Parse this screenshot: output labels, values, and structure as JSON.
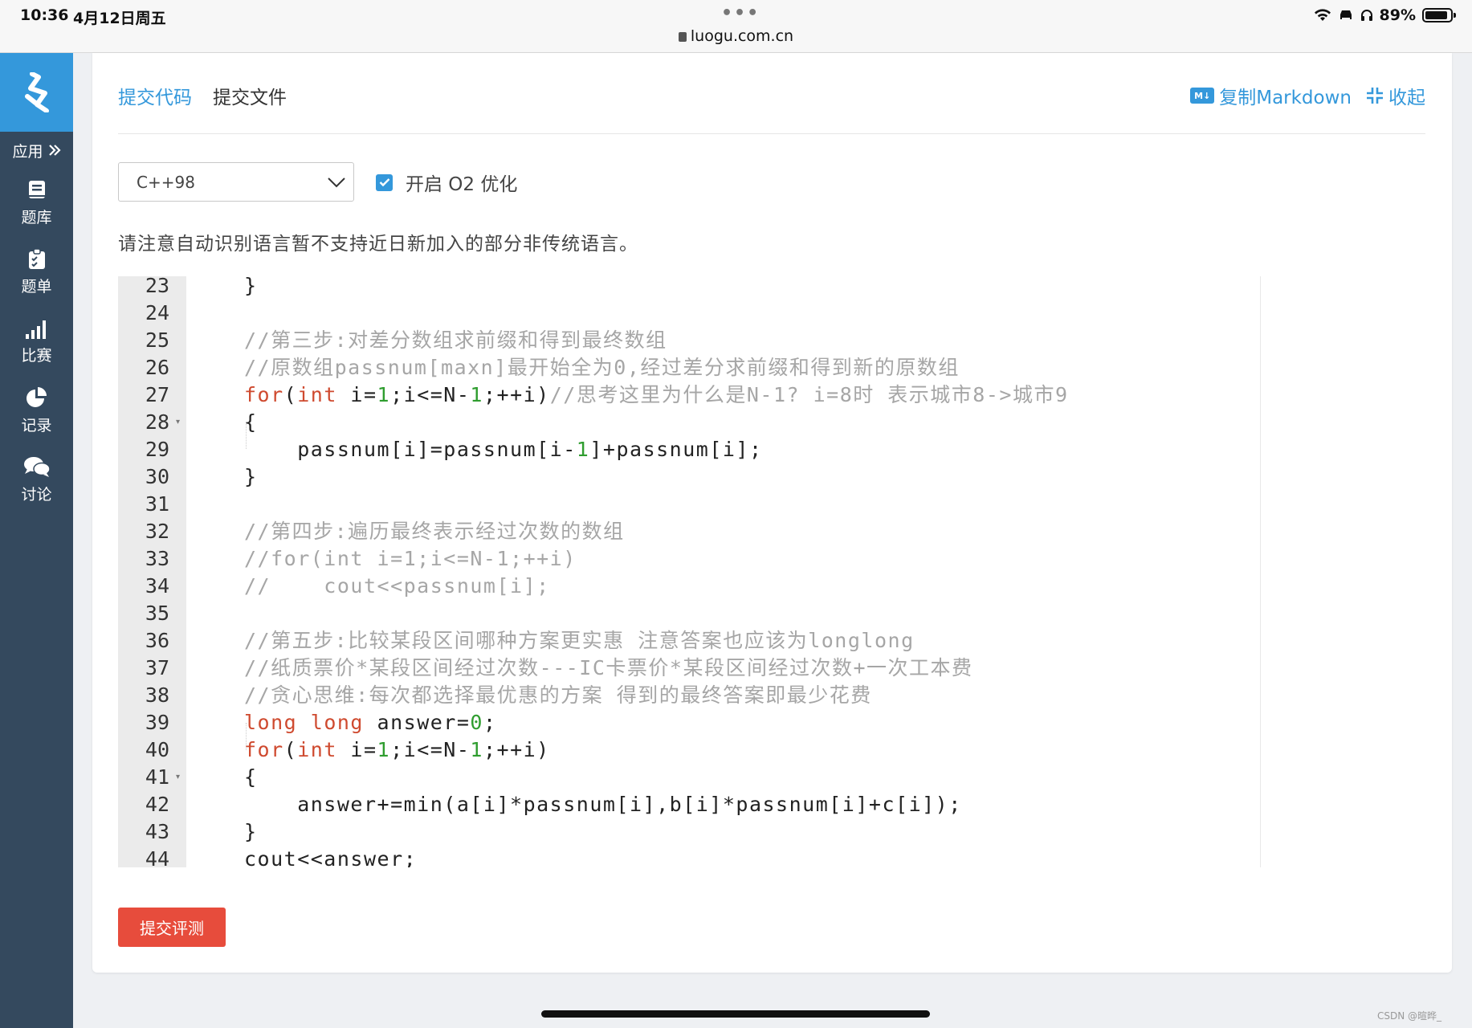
{
  "status": {
    "time": "10:36",
    "date": "4月12日周五",
    "url": "luogu.com.cn",
    "battery": "89%",
    "battery_level": 0.89
  },
  "sidebar": {
    "apps_label": "应用",
    "items": [
      {
        "label": "题库",
        "icon": "book-icon"
      },
      {
        "label": "题单",
        "icon": "clipboard-icon"
      },
      {
        "label": "比赛",
        "icon": "bar-chart-icon"
      },
      {
        "label": "记录",
        "icon": "pie-chart-icon"
      },
      {
        "label": "讨论",
        "icon": "chat-icon"
      }
    ]
  },
  "card": {
    "tab_code": "提交代码",
    "tab_file": "提交文件",
    "copy_markdown": "复制Markdown",
    "md_badge": "M↓",
    "collapse": "收起",
    "language": "C++98",
    "o2_label": "开启 O2 优化",
    "o2_checked": true,
    "notice": "请注意自动识别语言暂不支持近日新加入的部分非传统语言。",
    "submit": "提交评测"
  },
  "editor": {
    "line_numbers": [
      "23",
      "24",
      "25",
      "26",
      "27",
      "28",
      "29",
      "30",
      "31",
      "32",
      "33",
      "34",
      "35",
      "36",
      "37",
      "38",
      "39",
      "40",
      "41",
      "42",
      "43",
      "44"
    ],
    "folded_lines": [
      "28",
      "41"
    ],
    "lines": [
      [
        {
          "t": "}",
          "c": ""
        }
      ],
      [],
      [
        {
          "t": "//第三步:对差分数组求前缀和得到最终数组",
          "c": "cm"
        }
      ],
      [
        {
          "t": "//原数组passnum[maxn]最开始全为0,经过差分求前缀和得到新的原数组",
          "c": "cm"
        }
      ],
      [
        {
          "t": "for",
          "c": "kw"
        },
        {
          "t": "(",
          "c": ""
        },
        {
          "t": "int",
          "c": "ty"
        },
        {
          "t": " i=",
          "c": ""
        },
        {
          "t": "1",
          "c": "num"
        },
        {
          "t": ";i<=N-",
          "c": ""
        },
        {
          "t": "1",
          "c": "num"
        },
        {
          "t": ";++i)",
          "c": ""
        },
        {
          "t": "//思考这里为什么是N-1? i=8时 表示城市8->城市9",
          "c": "cm"
        }
      ],
      [
        {
          "t": "{",
          "c": ""
        }
      ],
      [
        {
          "t": "    passnum[i]=passnum[i-",
          "c": ""
        },
        {
          "t": "1",
          "c": "num"
        },
        {
          "t": "]+passnum[i];",
          "c": ""
        }
      ],
      [
        {
          "t": "}",
          "c": ""
        }
      ],
      [],
      [
        {
          "t": "//第四步:遍历最终表示经过次数的数组",
          "c": "cm"
        }
      ],
      [
        {
          "t": "//for(int i=1;i<=N-1;++i)",
          "c": "cm"
        }
      ],
      [
        {
          "t": "//    cout<<passnum[i];",
          "c": "cm"
        }
      ],
      [],
      [
        {
          "t": "//第五步:比较某段区间哪种方案更实惠 注意答案也应该为longlong",
          "c": "cm"
        }
      ],
      [
        {
          "t": "//纸质票价*某段区间经过次数---IC卡票价*某段区间经过次数+一次工本费",
          "c": "cm"
        }
      ],
      [
        {
          "t": "//贪心思维:每次都选择最优惠的方案 得到的最终答案即最少花费",
          "c": "cm"
        }
      ],
      [
        {
          "t": "long",
          "c": "ty"
        },
        {
          "t": " ",
          "c": ""
        },
        {
          "t": "long",
          "c": "ty"
        },
        {
          "t": " answer=",
          "c": ""
        },
        {
          "t": "0",
          "c": "num"
        },
        {
          "t": ";",
          "c": ""
        }
      ],
      [
        {
          "t": "for",
          "c": "kw"
        },
        {
          "t": "(",
          "c": ""
        },
        {
          "t": "int",
          "c": "ty"
        },
        {
          "t": " i=",
          "c": ""
        },
        {
          "t": "1",
          "c": "num"
        },
        {
          "t": ";i<=N-",
          "c": ""
        },
        {
          "t": "1",
          "c": "num"
        },
        {
          "t": ";++i)",
          "c": ""
        }
      ],
      [
        {
          "t": "{",
          "c": ""
        }
      ],
      [
        {
          "t": "    answer+=min(a[i]*passnum[i],b[i]*passnum[i]+c[i]);",
          "c": ""
        }
      ],
      [
        {
          "t": "}",
          "c": ""
        }
      ],
      [
        {
          "t": "cout<<answer;",
          "c": ""
        }
      ]
    ]
  },
  "watermark": "CSDN @暄晔_",
  "colors": {
    "accent": "#3498db",
    "sidebar": "#34495e",
    "submit": "#e74c3c",
    "comment": "#a6a6a6",
    "keyword": "#cf4a2f",
    "number": "#2f9d2f"
  }
}
